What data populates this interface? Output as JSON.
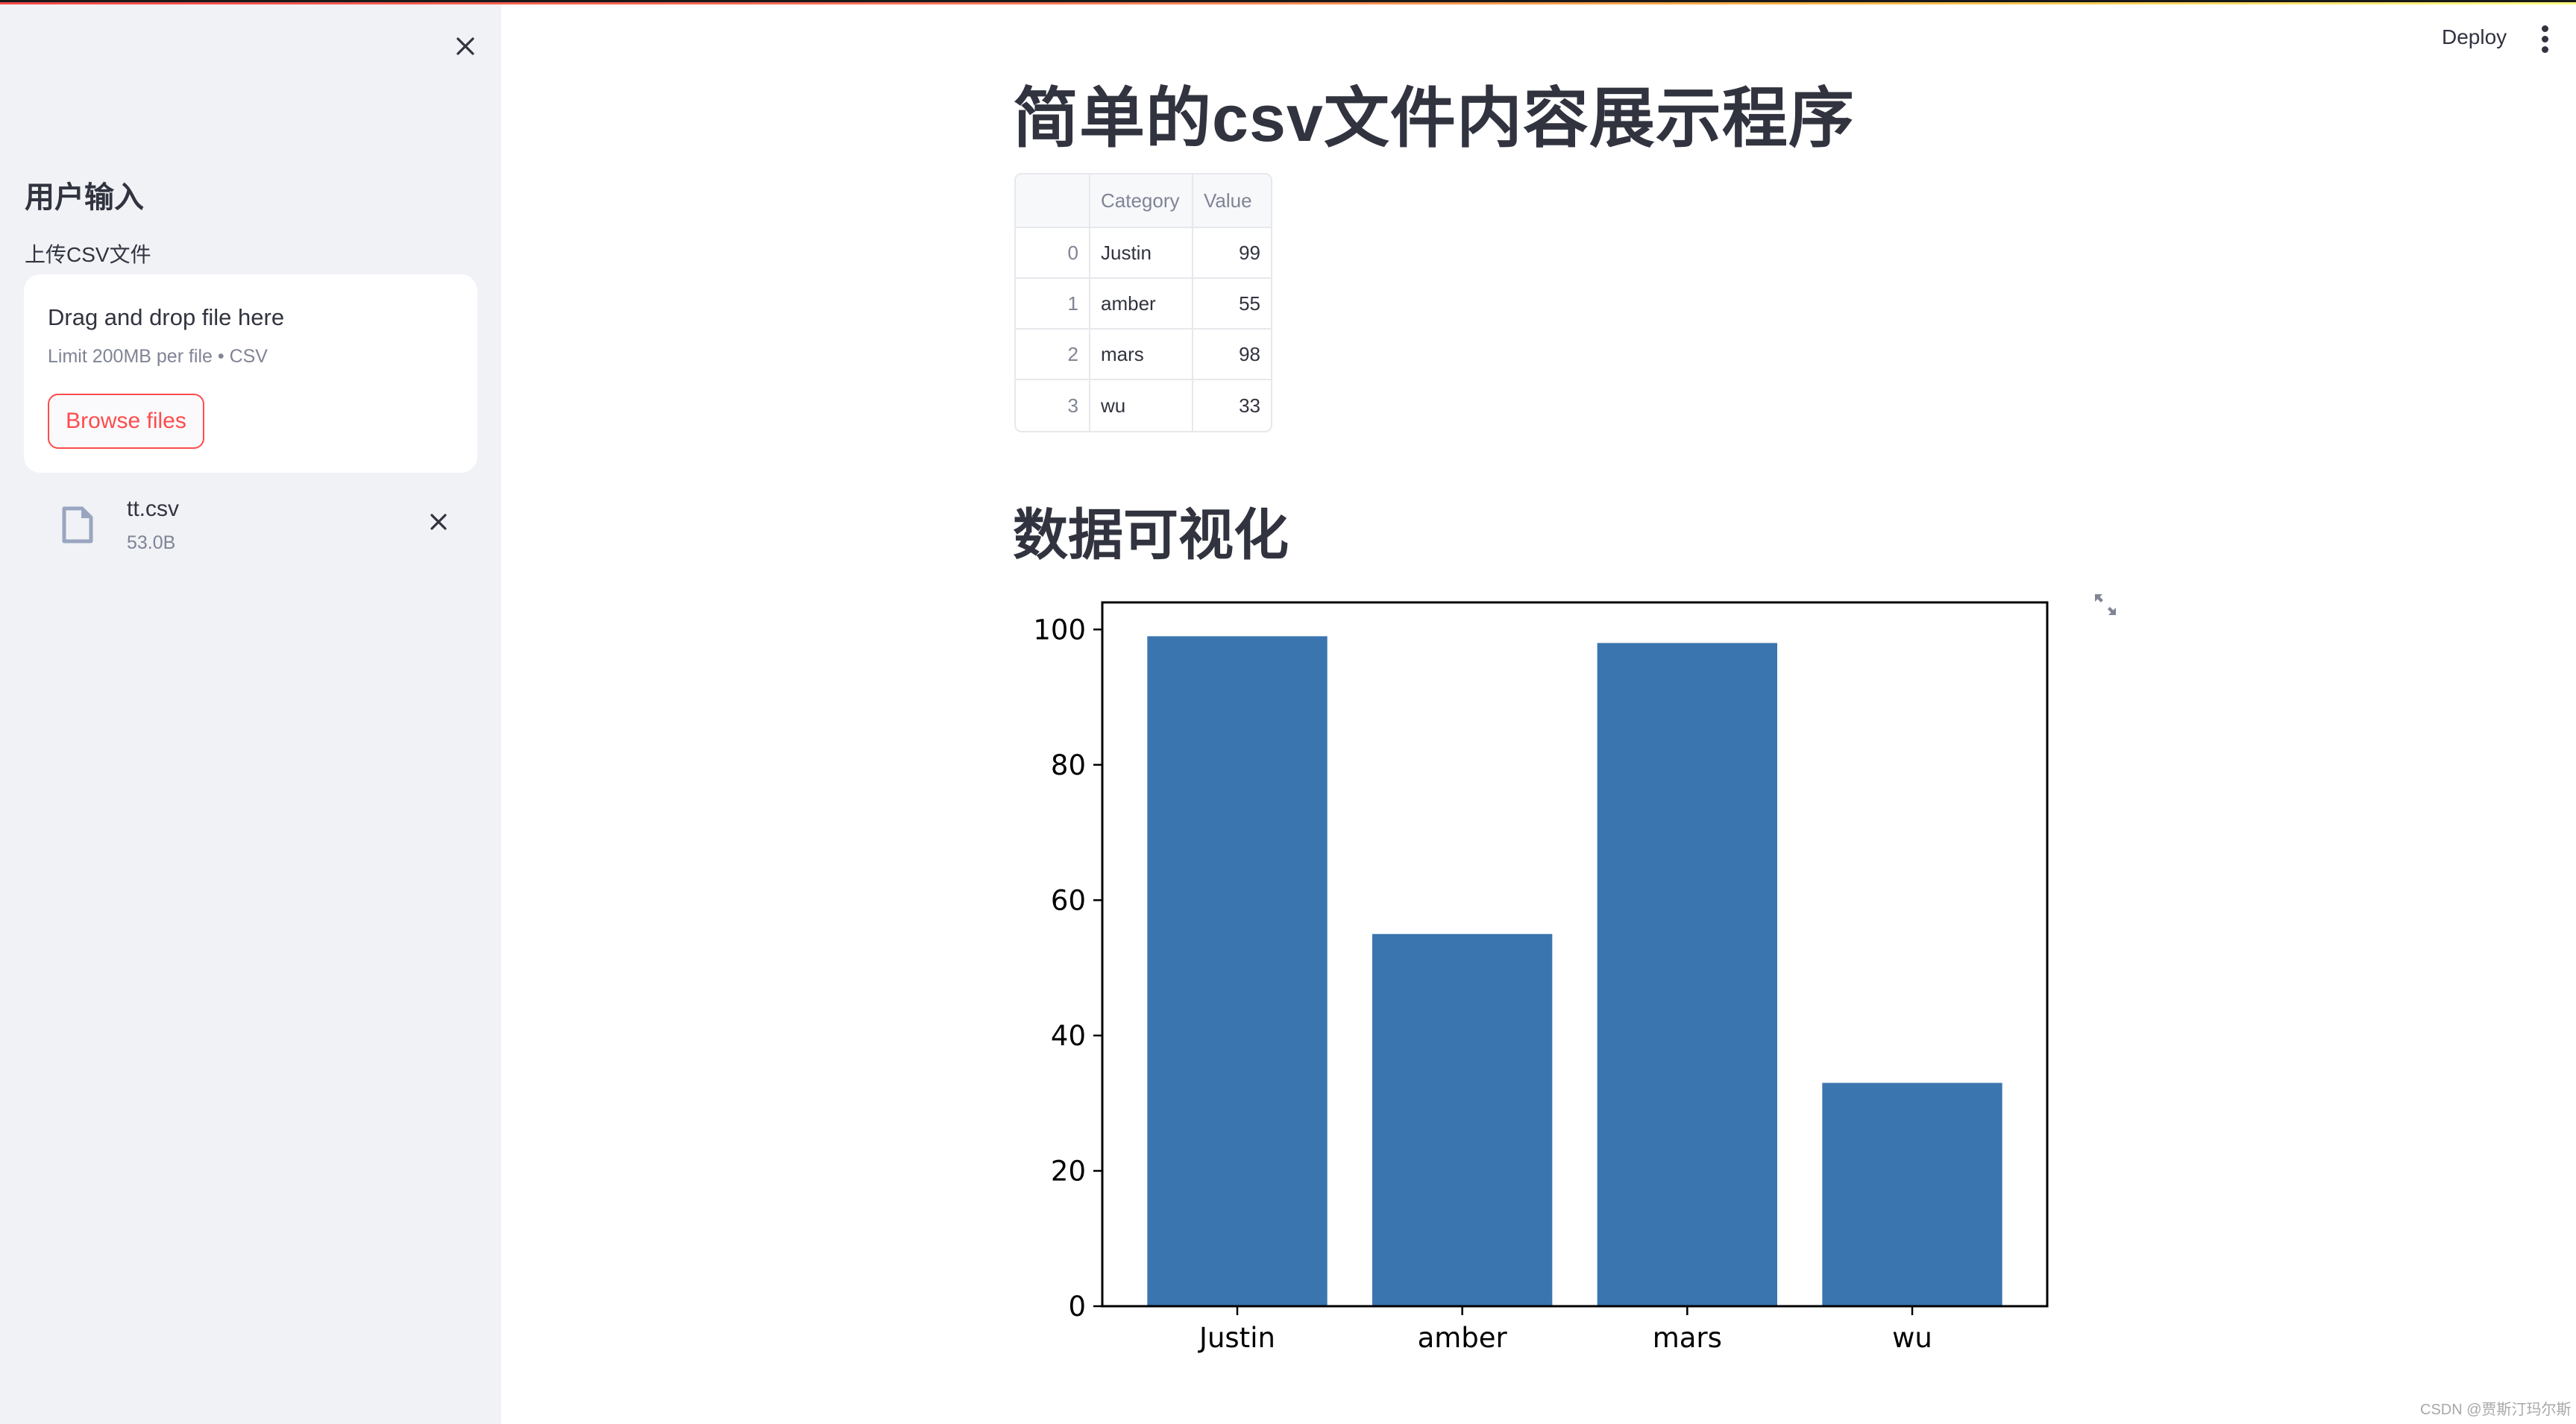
{
  "header": {
    "deploy_label": "Deploy",
    "menu_icon": "vertical-ellipsis-icon"
  },
  "sidebar": {
    "close_icon": "close-icon",
    "heading": "用户输入",
    "uploader": {
      "label": "上传CSV文件",
      "dropzone_title": "Drag and drop file here",
      "dropzone_limit": "Limit 200MB per file • CSV",
      "browse_label": "Browse files"
    },
    "uploaded_file": {
      "icon": "file-icon",
      "name": "tt.csv",
      "size": "53.0B",
      "remove_icon": "close-icon"
    }
  },
  "main": {
    "title": "简单的csv文件内容展示程序",
    "table": {
      "columns": [
        "",
        "Category",
        "Value"
      ],
      "rows": [
        {
          "index": "0",
          "category": "Justin",
          "value": "99"
        },
        {
          "index": "1",
          "category": "amber",
          "value": "55"
        },
        {
          "index": "2",
          "category": "mars",
          "value": "98"
        },
        {
          "index": "3",
          "category": "wu",
          "value": "33"
        }
      ]
    },
    "section_title": "数据可视化",
    "expand_icon": "fullscreen-expand-icon"
  },
  "chart_data": {
    "type": "bar",
    "title": "",
    "xlabel": "",
    "ylabel": "",
    "categories": [
      "Justin",
      "amber",
      "mars",
      "wu"
    ],
    "values": [
      99,
      55,
      98,
      33
    ],
    "ylim": [
      0,
      104
    ],
    "yticks": [
      0,
      20,
      40,
      60,
      80,
      100
    ],
    "grid": false,
    "legend": "none",
    "bar_color": "#3b75af"
  },
  "colors": {
    "accent": "#ff4b4b",
    "sidebar_bg": "#f0f2f6",
    "text": "#31333f",
    "muted_text": "#808495"
  },
  "watermark": "CSDN @贾斯汀玛尔斯"
}
